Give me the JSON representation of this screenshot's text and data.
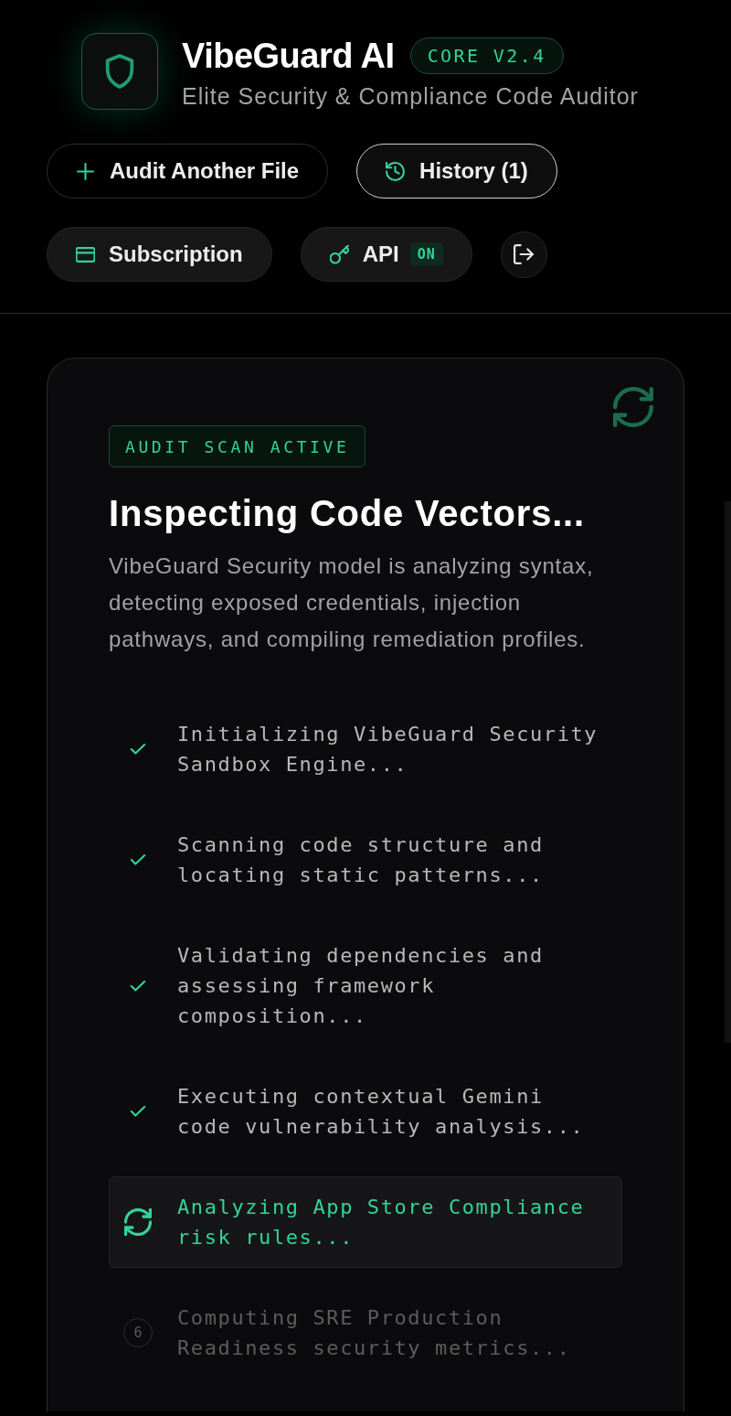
{
  "app": {
    "title": "VibeGuard AI",
    "version_badge": "CORE V2.4",
    "subtitle": "Elite Security & Compliance Code Auditor"
  },
  "actions": [
    {
      "kind": "outline",
      "label": "Audit Another File",
      "selected": false
    },
    {
      "kind": "outline",
      "label": "History (1)",
      "selected": true
    },
    {
      "kind": "filled",
      "label": "Subscription",
      "selected": false
    },
    {
      "kind": "filled",
      "label": "API",
      "badge": "ON",
      "selected": false
    },
    {
      "kind": "icon",
      "selected": false
    }
  ],
  "scan": {
    "status_badge": "AUDIT SCAN ACTIVE",
    "title": "Inspecting Code Vectors...",
    "description": "VibeGuard Security model is analyzing syntax, detecting exposed credentials, injection pathways, and compiling remediation profiles.",
    "steps": [
      {
        "text": "Initializing VibeGuard Security Sandbox Engine...",
        "done": true,
        "active": false
      },
      {
        "text": "Scanning code structure and locating static patterns...",
        "done": true,
        "active": false
      },
      {
        "text": "Validating dependencies and assessing framework composition...",
        "done": true,
        "active": false
      },
      {
        "text": "Executing contextual Gemini code vulnerability analysis...",
        "done": true,
        "active": false
      },
      {
        "text": "Analyzing App Store Compliance risk rules...",
        "done": false,
        "active": true
      },
      {
        "text": "Computing SRE Production Readiness security metrics...",
        "done": false,
        "active": false,
        "number": "6"
      }
    ]
  }
}
